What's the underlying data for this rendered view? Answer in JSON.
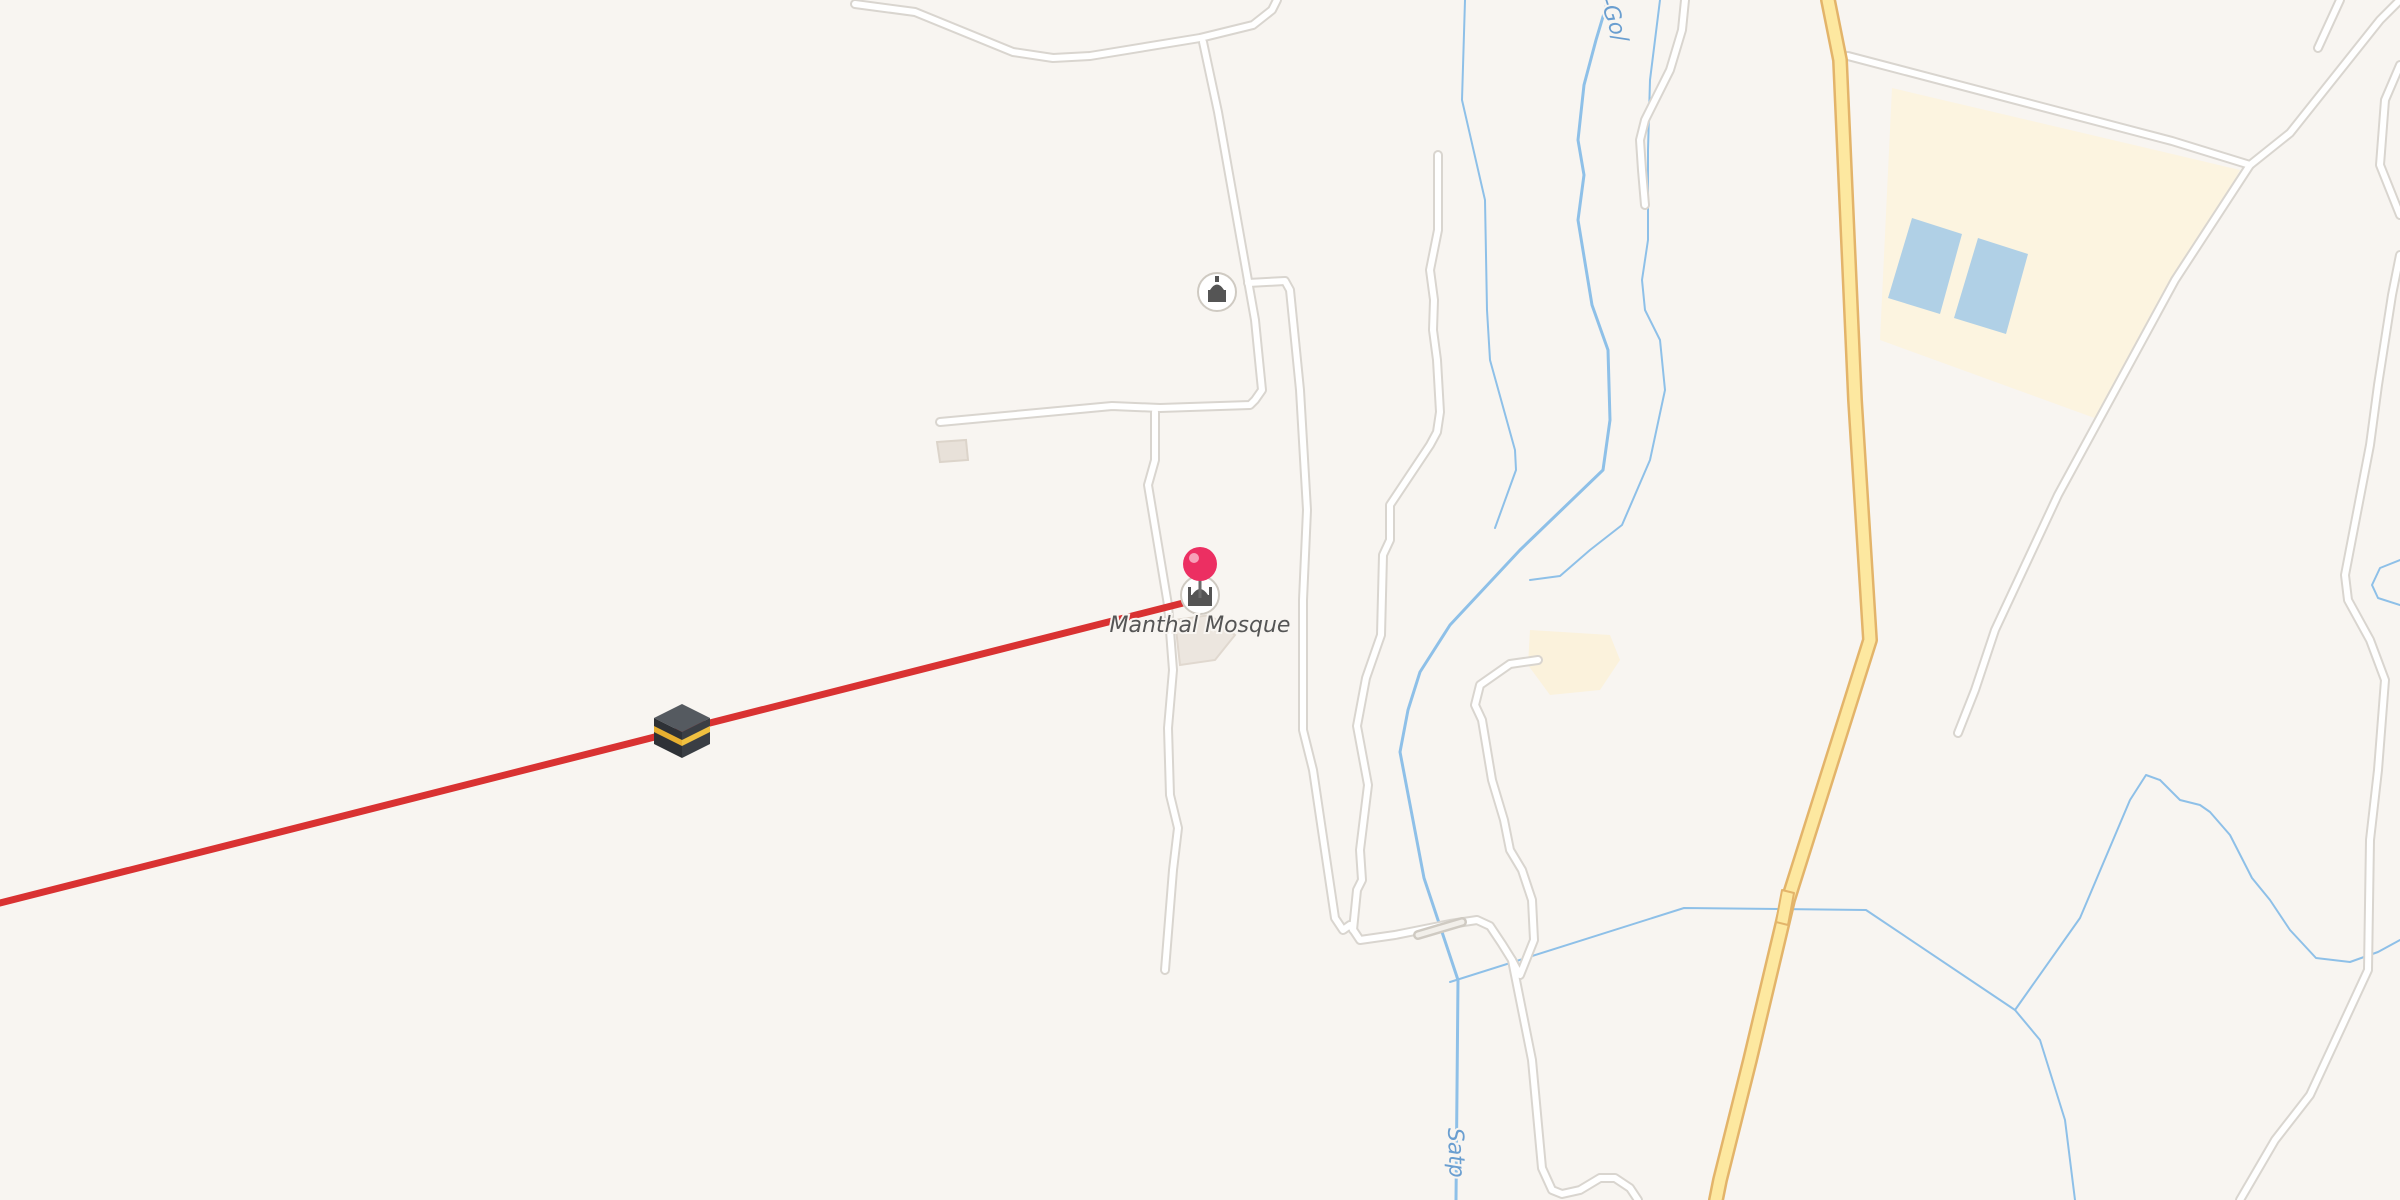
{
  "map": {
    "colors": {
      "background": "#f8f5f1",
      "road_fill": "#ffffff",
      "road_casing": "#d9d5cf",
      "main_road_fill": "#fde8a0",
      "main_road_casing": "#e3b46a",
      "water": "#8ec0e8",
      "water_area": "#b0d0e6",
      "industrial_area": "#fcf4e0",
      "qibla_line": "#d93232",
      "pin": "#ec2f62",
      "label_text": "#555555",
      "water_label": "#6a9ed0"
    },
    "poi": {
      "label": "Manthal Mosque",
      "icon": "mosque-icon"
    },
    "marker": {
      "icon": "location-pin-icon"
    },
    "kaaba": {
      "icon": "kaaba-icon"
    },
    "other_poi": {
      "icon": "mosque-icon"
    },
    "waterways": [
      {
        "label": "Satp"
      },
      {
        "label": "-Go/"
      }
    ]
  }
}
